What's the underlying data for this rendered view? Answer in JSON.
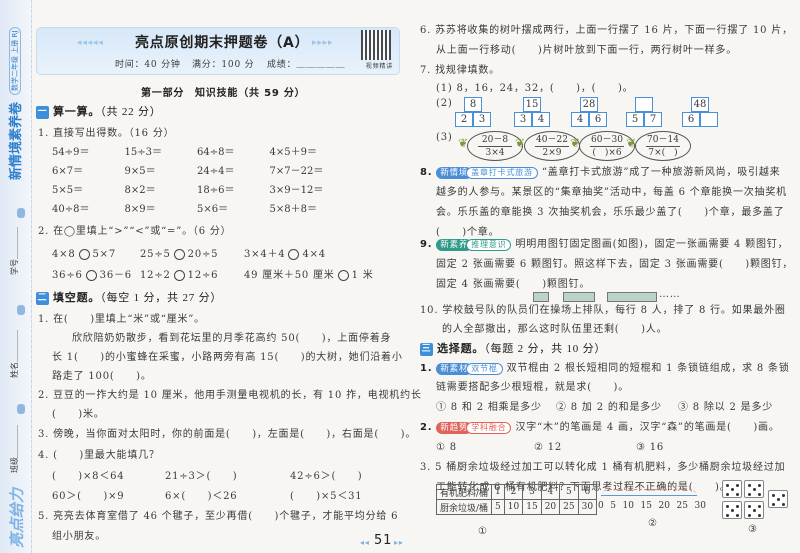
{
  "sidebar": {
    "brand": "亮点给力",
    "class_label": "班级",
    "name_label": "姓名",
    "id_label": "学号",
    "series": "新情境素养卷",
    "grade": "数学二年级 上册 RJ"
  },
  "header": {
    "title": "亮点原创期末押题卷（A）",
    "time": "时间：40 分钟",
    "full": "满分：100 分",
    "score": "成绩：",
    "qr_label": "视频精讲"
  },
  "part1": "第一部分　知识技能（共 59 分）",
  "s1": {
    "num": "一",
    "title": "算一算。",
    "note": "（共 22 分）"
  },
  "calc": {
    "q": "1. 直接写出得数。（16 分）",
    "items": [
      "54÷9＝",
      "15÷3＝",
      "64÷8＝",
      "4×5＋9＝",
      "6×7＝",
      "9×5＝",
      "24÷4＝",
      "7×7－22＝",
      "5×5＝",
      "8×2＝",
      "18÷6＝",
      "3×9－12＝",
      "40÷8＝",
      "8×9＝",
      "5×6＝",
      "5×8＋8＝"
    ]
  },
  "compare": {
    "q": "2. 在◯里填上“>”“<”或“=”。（6 分）",
    "items": [
      [
        "4×8",
        "5×7"
      ],
      [
        "25÷5",
        "20÷5"
      ],
      [
        "3×4＋4",
        "4×4"
      ],
      [
        "36÷6",
        "36－6"
      ],
      [
        "12÷2",
        "12÷6"
      ],
      [
        "49 厘米＋50 厘米",
        "1 米"
      ]
    ]
  },
  "s2": {
    "num": "二",
    "title": "填空题。",
    "note": "（每空 1 分，共 27 分）"
  },
  "fill": {
    "q1": [
      "1. 在(　　)里填上“米”或“厘米”。",
      "欣欣陪奶奶散步，看到花坛里的月季花高约 50(　　)，上面停着身",
      "长 1(　　)的小蜜蜂在采蜜，小路两旁有高 15(　　)的大树，她们沿着小",
      "路走了 100(　　)。"
    ],
    "q2": [
      "2. 豆豆的一拃大约是 10 厘米，他用手测量电视机的长，有 10 拃，电视机约长",
      "(　　)米。"
    ],
    "q3": "3. 傍晚，当你面对太阳时，你的前面是(　　)，左面是(　　)，右面是(　　)。",
    "q4": {
      "q": "4. (　　)里最大能填几？",
      "items": [
        "(　　)×8＜64",
        "21÷3＞(　　)",
        "42÷6＞(　　)",
        "60＞(　　)×9",
        "6×(　　)＜26",
        "(　　)×5＜31"
      ]
    },
    "q5": [
      "5. 亮亮去体育室借了 46 个毽子，至少再借(　　)个毽子，才能平均分给 6",
      "组小朋友。"
    ],
    "q6": [
      "6. 苏苏将收集的树叶摆成两行，上面一行摆了 16 片，下面一行摆了 10 片，",
      "从上面一行移动(　　)片树叶放到下面一行，两行树叶一样多。"
    ],
    "q7": {
      "q": "7. 找规律填数。",
      "p1": "(1) 8，16，24，32，(　　)，(　　)。",
      "p2": "(2)",
      "p3": "(3)",
      "tops": [
        "8",
        "15",
        "28",
        "",
        "48"
      ],
      "bottoms": [
        [
          "2",
          "3"
        ],
        [
          "3",
          "4"
        ],
        [
          "4",
          "6"
        ],
        [
          "5",
          "7"
        ],
        [
          "6",
          ""
        ]
      ],
      "oval_top": [
        "20－8",
        "40－22",
        "60－30",
        "70－14"
      ],
      "oval_bottom": [
        "3×4",
        "2×9",
        "(　)×6",
        "7×(　)"
      ]
    },
    "q8": {
      "num": "8.",
      "badge": "新情境",
      "tag": "盖章打卡式旅游",
      "lines": [
        "“盖章打卡式旅游”成了一种旅游新风尚，吸引越来",
        "越多的人参与。某景区的“集章抽奖”活动中，每盖 6 个章能换一次抽奖机",
        "会。乐乐盖的章能换 3 次抽奖机会，乐乐最少盖了(　　)个章，最多盖了",
        "(　　)个章。"
      ]
    },
    "q9": {
      "num": "9.",
      "badge": "新素养",
      "tag": "推理意识",
      "lines": [
        "明明用图钉固定图画(如图)，固定一张画需要 4 颗图钉，",
        "固定 2 张画需要 6 颗图钉。照这样下去，固定 3 张画需要(　　)颗图钉，",
        "固定 4 张画需要(　　)颗图钉。"
      ],
      "ellipsis": "……"
    },
    "q10": [
      "10. 学校鼓号队的队员们在操场上排队，每行 8 人，排了 8 行。如果最外圈",
      "的人全部撤出，那么这时队伍里还剩(　　)人。"
    ]
  },
  "s3": {
    "num": "三",
    "title": "选择题。",
    "note": "（每题 2 分，共 10 分）"
  },
  "choice": {
    "q1": {
      "num": "1.",
      "badge": "新素材",
      "tag": "双节棍",
      "lines": [
        "双节棍由 2 根长短相同的短棍和 1 条锁链组成，求 8 条锁",
        "链需要搭配多少根短棍，就是求(　　)。"
      ],
      "options": [
        "① 8 和 2 相乘是多少",
        "② 8 加 2 的和是多少",
        "③ 8 除以 2 是多少"
      ]
    },
    "q2": {
      "num": "2.",
      "badge": "新趋势",
      "tag": "学科融合",
      "line": "汉字“木”的笔画是 4 画，汉字“森”的笔画是(　　)画。",
      "options": [
        "① 8",
        "② 12",
        "③ 16"
      ]
    },
    "q3": {
      "lines": [
        "3. 5 桶厨余垃圾经过加工可以转化成 1 桶有机肥料，多少桶厨余垃圾经过加",
        "工能转化成 6 桶有机肥料？下面思考过程不正确的是(　　)。"
      ],
      "table": {
        "row1_label": "有机肥料/桶",
        "row1": [
          "1",
          "2",
          "3",
          "4",
          "5",
          "6"
        ],
        "row2_label": "厨余垃圾/桶",
        "row2": [
          "5",
          "10",
          "15",
          "20",
          "25",
          "30"
        ]
      },
      "numberline": [
        "0",
        "5",
        "10",
        "15",
        "20",
        "25",
        "30"
      ],
      "labels": [
        "①",
        "②",
        "③"
      ]
    }
  },
  "page_number": "51",
  "colors": {
    "accent": "#3d8fd9",
    "badge_situation": "#4a8fd6",
    "badge_literacy": "#2f9a8a",
    "badge_material": "#4a8fd6",
    "badge_trend": "#e0645c"
  }
}
